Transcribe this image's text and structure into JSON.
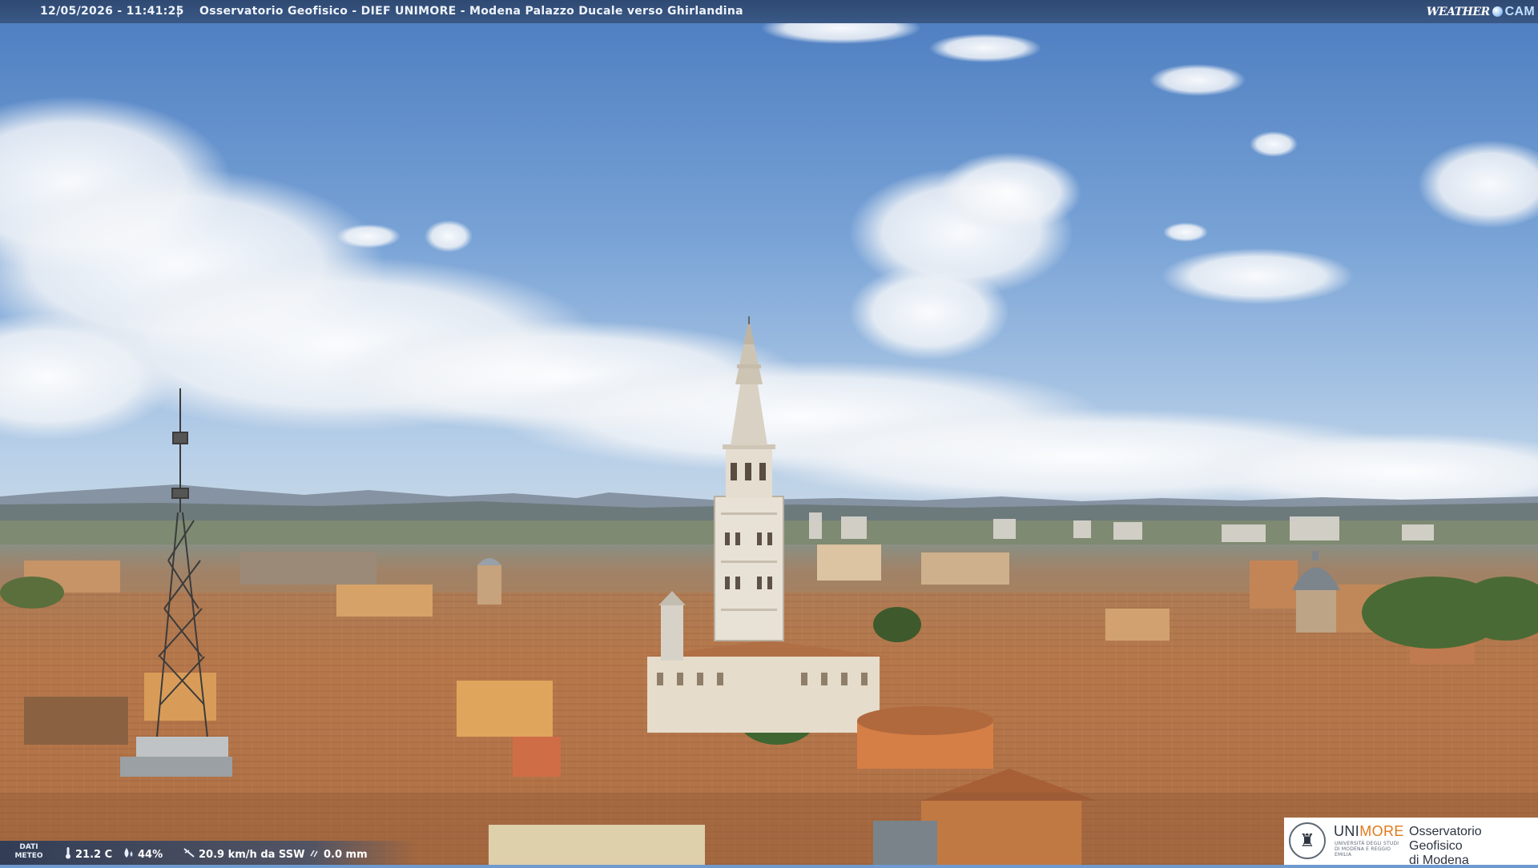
{
  "caption": {
    "timestamp": "12/05/2026 - 11:41:25",
    "separator": "|",
    "title": "Osservatorio Geofisico - DIEF UNIMORE - Modena Palazzo Ducale verso Ghirlandina"
  },
  "brand": {
    "word": "WEATHER",
    "cam": "CAM"
  },
  "meteo": {
    "label": "DATI METEO",
    "temperature": "21.2 C",
    "humidity": "44%",
    "wind": "20.9 km/h da SSW",
    "rain": "0.0 mm"
  },
  "logo": {
    "uni_a": "UNI",
    "uni_b": "MORE",
    "uni_sub": "UNIVERSITÀ DEGLI STUDI DI MODENA E REGGIO EMILIA",
    "dept_line1": "Osservatorio Geofisico",
    "dept_line2": "di Modena"
  },
  "colors": {
    "sky_top": "#4f7fc0",
    "sky_bottom": "#bcd2ea",
    "roofs": "#b8784a",
    "accent_orange": "#e07a1c"
  },
  "icons": {
    "thermometer": "thermometer-icon",
    "humidity": "droplet-icon",
    "wind": "wind-icon",
    "rain": "rain-icon"
  }
}
